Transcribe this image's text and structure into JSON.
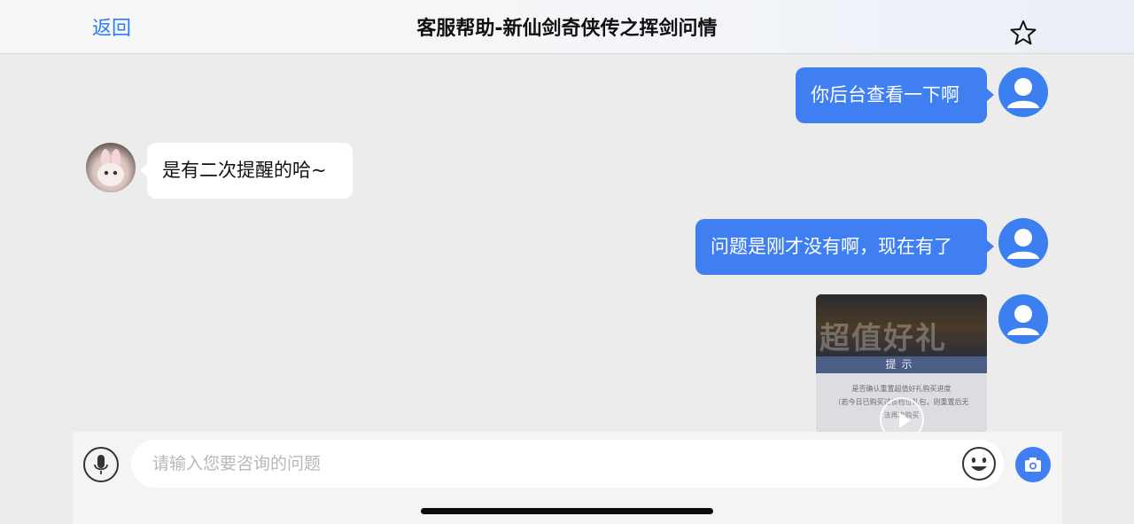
{
  "header": {
    "back_label": "返回",
    "title": "客服帮助-新仙剑奇侠传之挥剑问情"
  },
  "messages": [
    {
      "side": "out",
      "text": "你后台查看一下啊"
    },
    {
      "side": "in",
      "text": "是有二次提醒的哈~"
    },
    {
      "side": "out",
      "text": "问题是刚才没有啊，现在有了"
    },
    {
      "side": "out",
      "type": "image",
      "image": {
        "banner_text": "超值好礼",
        "dialog_title": "提示",
        "line1": "是否确认重置超值好礼购买进度",
        "line2": "（若今日已购买过该档位礼包，则重置后无",
        "line3": "法再次购买"
      }
    }
  ],
  "input": {
    "placeholder": "请输入您要咨询的问题"
  },
  "colors": {
    "accent": "#3f7ff2",
    "link": "#2f7bf5",
    "background": "#ececec"
  },
  "icons": [
    "star-icon",
    "user-avatar-icon",
    "microphone-icon",
    "emoji-icon",
    "camera-icon",
    "play-icon"
  ]
}
